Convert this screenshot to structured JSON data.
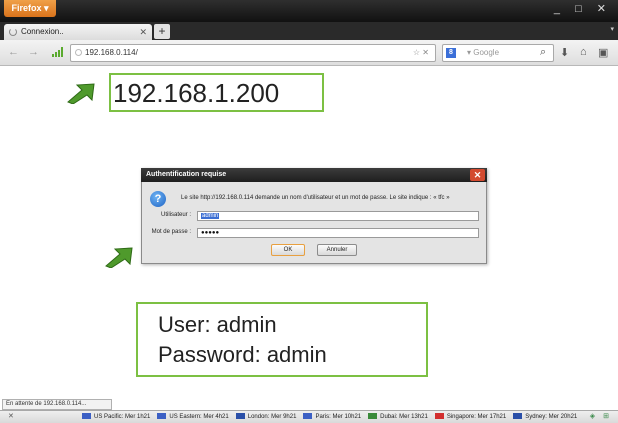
{
  "browser": {
    "menu_button": "Firefox ▾",
    "window_controls": "_ □ ✕",
    "tab": {
      "label": "Connexion..",
      "close": "✕"
    },
    "new_tab": "+",
    "tab_list": "▾",
    "nav": {
      "back": "←",
      "forward": "→"
    },
    "url": "192.168.0.114/",
    "url_tools": "☆ ✕",
    "search": {
      "engine_icon": "8",
      "placeholder": "▾ Google"
    },
    "toolbar_icons": [
      "search-icon",
      "download-icon",
      "home-icon",
      "addons-icon"
    ]
  },
  "annotations": {
    "ip": "192.168.1.200",
    "user": "User: admin",
    "password": "Password: admin",
    "accent_color": "#7cc043"
  },
  "dialog": {
    "title": "Authentification requise",
    "close": "✕",
    "message": "Le site http://192.168.0.114 demande un nom d'utilisateur et un mot de passe. Le site indique : « tfc »",
    "user_label": "Utilisateur :",
    "user_value": "admin",
    "password_label": "Mot de passe :",
    "password_value": "●●●●●",
    "ok": "OK",
    "cancel": "Annuler"
  },
  "status": {
    "text": "En attente de 192.168.0.114...",
    "close": "✕",
    "clocks": [
      {
        "label": "US Pacific: Mer 1h21",
        "color": "#3b5fc4"
      },
      {
        "label": "US Eastern: Mer 4h21",
        "color": "#3b5fc4"
      },
      {
        "label": "London: Mer 9h21",
        "color": "#2a4fa8"
      },
      {
        "label": "Paris: Mer 10h21",
        "color": "#3b5fc4"
      },
      {
        "label": "Dubai: Mer 13h21",
        "color": "#3a8a3a"
      },
      {
        "label": "Singapore: Mer 17h21",
        "color": "#d22e2e"
      },
      {
        "label": "Sydney: Mer 20h21",
        "color": "#2a4fa8"
      }
    ]
  }
}
